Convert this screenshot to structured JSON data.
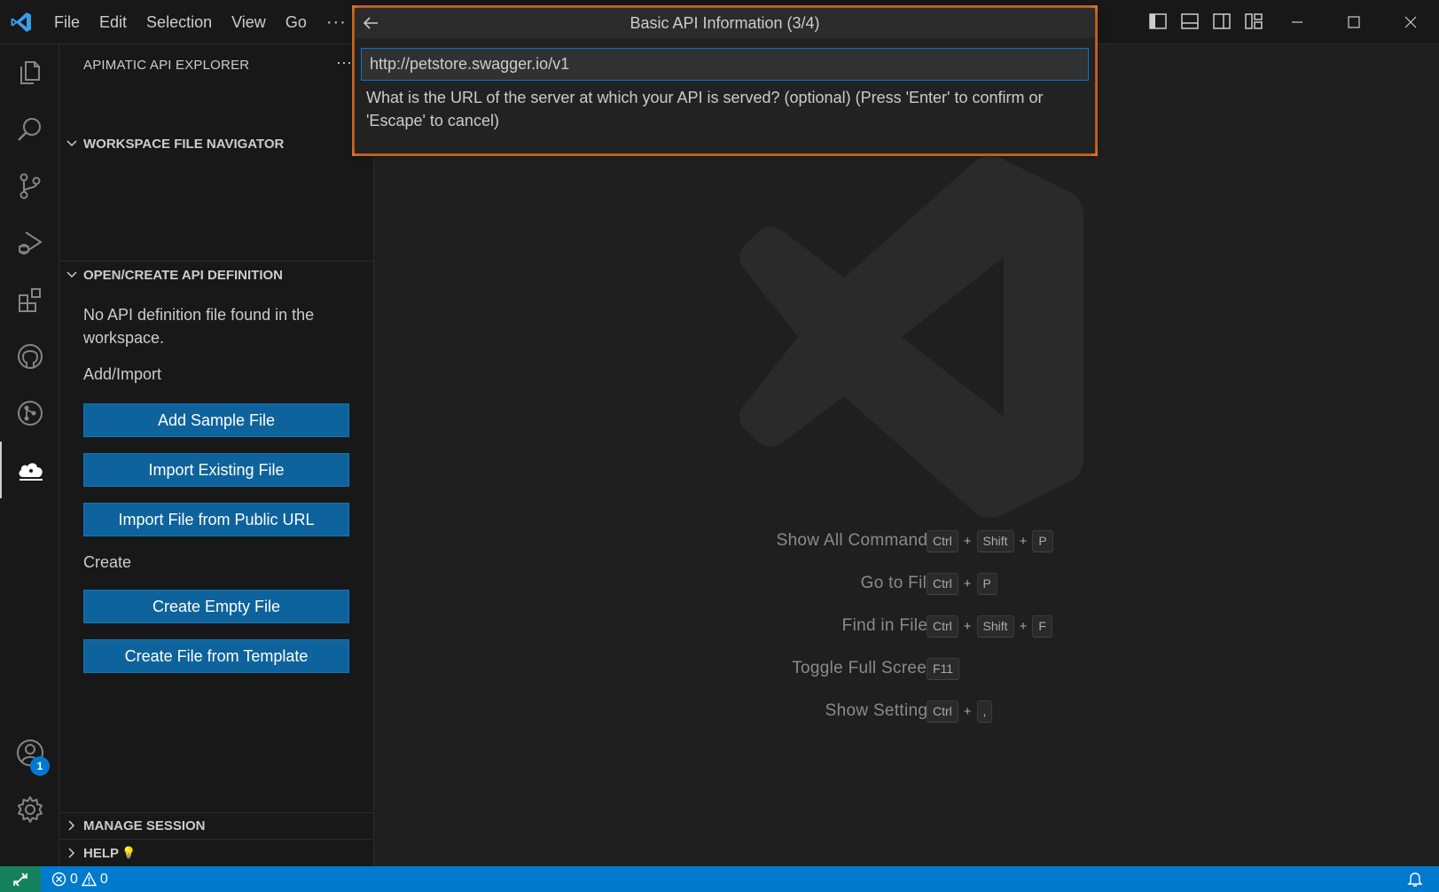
{
  "menu": {
    "items": [
      "File",
      "Edit",
      "Selection",
      "View",
      "Go"
    ],
    "more": "···"
  },
  "sidebar": {
    "title": "APIMATIC API EXPLORER",
    "more": "···",
    "workspace_section": "WORKSPACE FILE NAVIGATOR",
    "definition_section": "OPEN/CREATE API DEFINITION",
    "no_def_text": "No API definition file found in the workspace.",
    "add_import_label": "Add/Import",
    "create_label": "Create",
    "buttons": {
      "add_sample": "Add Sample File",
      "import_existing": "Import Existing File",
      "import_url": "Import File from Public URL",
      "create_empty": "Create Empty File",
      "create_template": "Create File from Template"
    },
    "manage_session": "MANAGE SESSION",
    "help": "HELP",
    "help_emoji": "💡"
  },
  "activity": {
    "accounts_badge": "1"
  },
  "quick_input": {
    "title": "Basic API Information (3/4)",
    "value": "http://petstore.swagger.io/v1",
    "message": "What is the URL of the server at which your API is served? (optional) (Press 'Enter' to confirm or 'Escape' to cancel)",
    "highlight_color": "#ee7b2c"
  },
  "shortcuts": [
    {
      "label": "Show All Commands",
      "keys": [
        "Ctrl",
        "Shift",
        "P"
      ]
    },
    {
      "label": "Go to File",
      "keys": [
        "Ctrl",
        "P"
      ]
    },
    {
      "label": "Find in Files",
      "keys": [
        "Ctrl",
        "Shift",
        "F"
      ]
    },
    {
      "label": "Toggle Full Screen",
      "keys": [
        "F11"
      ]
    },
    {
      "label": "Show Settings",
      "keys": [
        "Ctrl",
        ","
      ]
    }
  ],
  "status": {
    "errors": "0",
    "warnings": "0",
    "bar_color": "#007acc",
    "remote_color": "#16825d"
  },
  "icons": {
    "logo": "vscode-logo-icon",
    "explorer": "files-icon",
    "search": "search-icon",
    "scm": "source-control-icon",
    "debug": "run-debug-icon",
    "extensions": "extensions-icon",
    "github": "github-icon",
    "gitgraph": "git-graph-icon",
    "apimatic": "cloud-icon",
    "accounts": "accounts-icon",
    "settings": "gear-icon"
  }
}
